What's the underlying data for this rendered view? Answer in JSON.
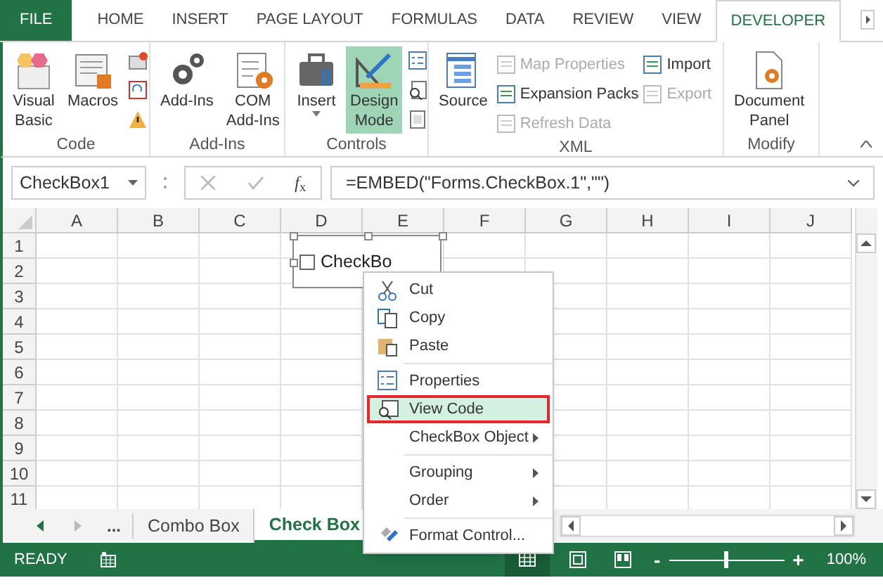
{
  "ribbon_tabs": [
    {
      "label": "FILE",
      "kind": "file",
      "selected": false
    },
    {
      "label": "HOME",
      "kind": "tab",
      "selected": false
    },
    {
      "label": "INSERT",
      "kind": "tab",
      "selected": false
    },
    {
      "label": "PAGE LAYOUT",
      "kind": "tab",
      "selected": false
    },
    {
      "label": "FORMULAS",
      "kind": "tab",
      "selected": false
    },
    {
      "label": "DATA",
      "kind": "tab",
      "selected": false
    },
    {
      "label": "REVIEW",
      "kind": "tab",
      "selected": false
    },
    {
      "label": "VIEW",
      "kind": "tab",
      "selected": false
    },
    {
      "label": "DEVELOPER",
      "kind": "tab",
      "selected": true
    }
  ],
  "ribbon_groups": [
    {
      "label": "Code",
      "items": [
        {
          "kind": "large",
          "lines": [
            "Visual",
            "Basic"
          ]
        },
        {
          "kind": "large",
          "lines": [
            "Macros"
          ]
        },
        {
          "kind": "icons"
        }
      ]
    },
    {
      "label": "Add-Ins",
      "items": [
        {
          "kind": "large",
          "lines": [
            "Add-Ins"
          ]
        },
        {
          "kind": "large",
          "lines": [
            "COM",
            "Add-Ins"
          ]
        }
      ]
    },
    {
      "label": "Controls",
      "items": [
        {
          "kind": "large",
          "lines": [
            "Insert"
          ],
          "dropdown": true
        },
        {
          "kind": "large",
          "lines": [
            "Design",
            "Mode"
          ],
          "on": true
        },
        {
          "kind": "icons"
        }
      ]
    },
    {
      "label": "XML",
      "items": [
        {
          "kind": "large",
          "lines": [
            "Source"
          ]
        },
        {
          "kind": "small",
          "rows": [
            {
              "label": "Map Properties",
              "disabled": true
            },
            {
              "label": "Expansion Packs",
              "disabled": false
            },
            {
              "label": "Refresh Data",
              "disabled": true
            }
          ]
        },
        {
          "kind": "small",
          "rows": [
            {
              "label": "Import",
              "disabled": false
            },
            {
              "label": "Export",
              "disabled": true
            }
          ]
        }
      ]
    },
    {
      "label": "Modify",
      "items": [
        {
          "kind": "large",
          "lines": [
            "Document",
            "Panel"
          ]
        }
      ]
    }
  ],
  "formula_bar": {
    "name_box": "CheckBox1",
    "function_label": "*f*$_{x}$",
    "formula": "=EMBED(\"Forms.CheckBox.1\",\"\")"
  },
  "columns": [
    "A",
    "B",
    "C",
    "D",
    "E",
    "F",
    "G",
    "H",
    "I",
    "J"
  ],
  "rows": [
    "1",
    "2",
    "3",
    "4",
    "5",
    "6",
    "7",
    "8",
    "9",
    "10",
    "11"
  ],
  "checkbox_control": {
    "label": "CheckBo",
    "checked": false
  },
  "context_menu": {
    "sections": [
      [
        {
          "label": "Cut",
          "submenu": false,
          "selected": false
        },
        {
          "label": "Copy",
          "submenu": false,
          "selected": false
        },
        {
          "label": "Paste",
          "submenu": false,
          "selected": false
        }
      ],
      [
        {
          "label": "Properties",
          "submenu": false,
          "selected": false
        },
        {
          "label": "View Code",
          "submenu": false,
          "selected": true
        },
        {
          "label": "CheckBox Object",
          "submenu": true,
          "selected": false
        }
      ],
      [
        {
          "label": "Grouping",
          "submenu": true,
          "selected": false
        },
        {
          "label": "Order",
          "submenu": true,
          "selected": false
        }
      ],
      [
        {
          "label": "Format Control...",
          "submenu": false,
          "selected": false
        }
      ]
    ]
  },
  "sheet_tabs": {
    "overflow": "...",
    "tabs": [
      {
        "label": "Combo Box",
        "selected": false
      },
      {
        "label": "Check Box",
        "selected": true
      }
    ]
  },
  "status_bar": {
    "status": "READY",
    "zoom_out": "-",
    "zoom_in": "+",
    "zoom": {
      "level": 0.5
    },
    "zoom_text": "100%"
  }
}
